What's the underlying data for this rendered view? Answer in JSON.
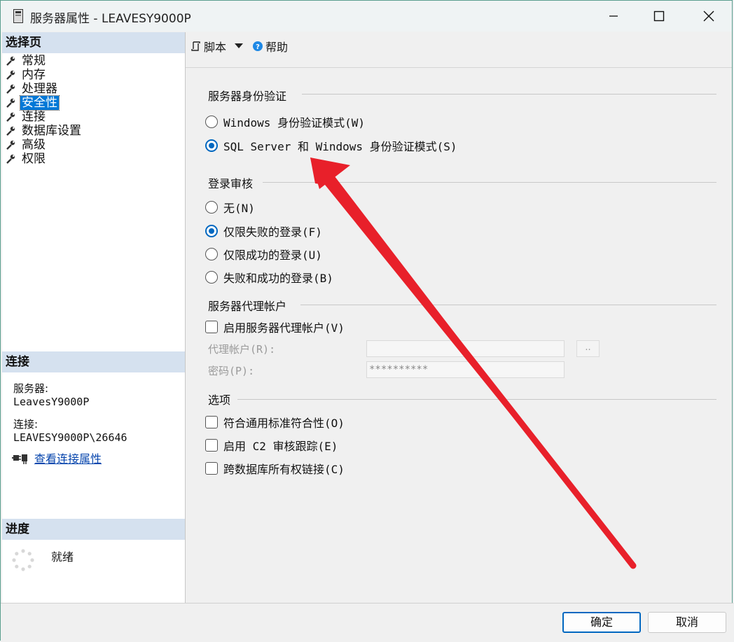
{
  "window": {
    "title": "服务器属性 - LEAVESY9000P"
  },
  "left": {
    "select_page_header": "选择页",
    "nav_items": [
      {
        "label": "常规"
      },
      {
        "label": "内存"
      },
      {
        "label": "处理器"
      },
      {
        "label": "安全性"
      },
      {
        "label": "连接"
      },
      {
        "label": "数据库设置"
      },
      {
        "label": "高级"
      },
      {
        "label": "权限"
      }
    ],
    "selected_nav": "安全性",
    "connection_header": "连接",
    "server_label": "服务器:",
    "server_value": "LeavesY9000P",
    "connection_label": "连接:",
    "connection_value": "LEAVESY9000P\\26646",
    "view_link": "查看连接属性",
    "progress_header": "进度",
    "progress_status": "就绪"
  },
  "toolbar": {
    "script_label": "脚本",
    "help_label": "帮助"
  },
  "auth": {
    "title": "服务器身份验证",
    "options": [
      {
        "label": "Windows 身份验证模式(W)",
        "checked": false
      },
      {
        "label": "SQL Server 和 Windows 身份验证模式(S)",
        "checked": true
      }
    ]
  },
  "audit": {
    "title": "登录审核",
    "options": [
      {
        "label": "无(N)",
        "checked": false
      },
      {
        "label": "仅限失败的登录(F)",
        "checked": true
      },
      {
        "label": "仅限成功的登录(U)",
        "checked": false
      },
      {
        "label": "失败和成功的登录(B)",
        "checked": false
      }
    ]
  },
  "proxy": {
    "title": "服务器代理帐户",
    "enable_label": "启用服务器代理帐户(V)",
    "account_label": "代理帐户(R):",
    "account_value": "",
    "password_label": "密码(P):",
    "password_value": "**********",
    "browse_label": ".."
  },
  "options": {
    "title": "选项",
    "items": [
      {
        "label": "符合通用标准符合性(O)",
        "checked": false
      },
      {
        "label": "启用 C2 审核跟踪(E)",
        "checked": false
      },
      {
        "label": "跨数据库所有权链接(C)",
        "checked": false
      }
    ]
  },
  "buttons": {
    "ok": "确定",
    "cancel": "取消"
  },
  "colors": {
    "accent": "#0067c0",
    "annotation_arrow": "#e8202a",
    "selected_bg": "#0078d7"
  }
}
